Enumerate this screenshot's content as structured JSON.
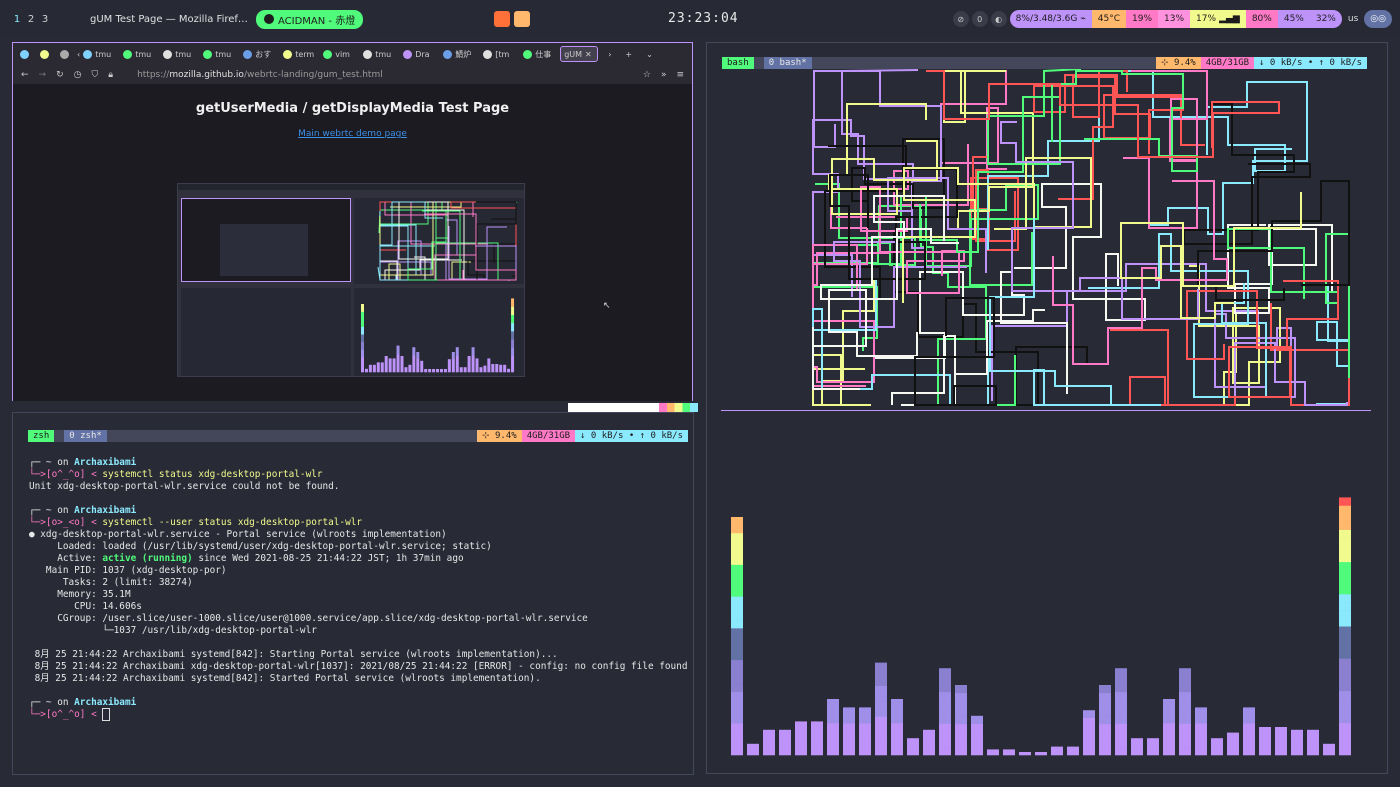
{
  "topbar": {
    "workspaces": [
      "1",
      "2",
      "3"
    ],
    "window_title": "gUM Test Page — Mozilla Firef…",
    "song": "ACIDMAN - 赤燈",
    "clock": "23:23:04",
    "status_items": [
      {
        "label": "8%/3.48/3.6G",
        "color": "#bd93f9"
      },
      {
        "label": "45°C",
        "color": "#ffb86c"
      },
      {
        "label": "19%",
        "color": "#ff79c6"
      },
      {
        "label": "13%",
        "color": "#ff92df"
      },
      {
        "label": "17%",
        "color": "#f1fa8c"
      },
      {
        "label": "80%",
        "color": "#ff79c6"
      },
      {
        "label": "45%",
        "color": "#bd93f9"
      },
      {
        "label": "32%",
        "color": "#bd93f9"
      },
      {
        "label": "us",
        "color": "#282a36"
      }
    ],
    "right_icons": [
      "eye-off-icon",
      "zero-icon",
      "steam-icon",
      "discord-icon"
    ],
    "zero_label": "0"
  },
  "browser": {
    "tabs": [
      {
        "label": "tmu",
        "color": "#7fd1ff"
      },
      {
        "label": "tmu",
        "color": "#50fa7b"
      },
      {
        "label": "tmu",
        "color": "#e0e0e0"
      },
      {
        "label": "tmu",
        "color": "#50fa7b"
      },
      {
        "label": "おす",
        "color": "#6a9fe8"
      },
      {
        "label": "term",
        "color": "#f1fa8c"
      },
      {
        "label": "vim",
        "color": "#50fa7b"
      },
      {
        "label": "tmu",
        "color": "#e0e0e0"
      },
      {
        "label": "Dra",
        "color": "#bd93f9"
      },
      {
        "label": "鯖炉",
        "color": "#6a9fe8"
      },
      {
        "label": "[tm",
        "color": "#e0e0e0"
      },
      {
        "label": "仕事",
        "color": "#50fa7b"
      },
      {
        "label": "gUM",
        "color": "#ff5555"
      }
    ],
    "url_prefix": "https://",
    "url_host": "mozilla.github.io",
    "url_path": "/webrtc-landing/gum_test.html",
    "page_title": "getUserMedia / getDisplayMedia Test Page",
    "page_link": "Main webrtc demo page"
  },
  "zsh": {
    "status_left": "zsh",
    "status_win": "0 zsh*",
    "cpu": "9.4%",
    "mem": "4GB/31GB",
    "net": "↓ 0 kB/s • ↑ 0 kB/s",
    "user": "Archaxibami",
    "lines": {
      "p1": "┌─ ~ on ",
      "c1prompt": "└─>[o^_^o] < ",
      "c1": "systemctl status xdg-desktop-portal-wlr",
      "o1": "Unit xdg-desktop-portal-wlr.service could not be found.",
      "p2": "┌─ ~ on ",
      "c2prompt": "└─>[o>_<o] < ",
      "c2": "systemctl --user status xdg-desktop-portal-wlr",
      "s1": "● xdg-desktop-portal-wlr.service - Portal service (wlroots implementation)",
      "s2": "     Loaded: loaded (/usr/lib/systemd/user/xdg-desktop-portal-wlr.service; static)",
      "s3a": "     Active: ",
      "s3b": "active (running)",
      "s3c": " since Wed 2021-08-25 21:44:22 JST; 1h 37min ago",
      "s4": "   Main PID: 1037 (xdg-desktop-por)",
      "s5": "      Tasks: 2 (limit: 38274)",
      "s6": "     Memory: 35.1M",
      "s7": "        CPU: 14.606s",
      "s8": "     CGroup: /user.slice/user-1000.slice/user@1000.service/app.slice/xdg-desktop-portal-wlr.service",
      "s9": "             └─1037 /usr/lib/xdg-desktop-portal-wlr",
      "j1": " 8月 25 21:44:22 Archaxibami systemd[842]: Starting Portal service (wlroots implementation)...",
      "j2": " 8月 25 21:44:22 Archaxibami xdg-desktop-portal-wlr[1037]: 2021/08/25 21:44:22 [ERROR] - config: no config file found",
      "j3": " 8月 25 21:44:22 Archaxibami systemd[842]: Started Portal service (wlroots implementation).",
      "p3": "┌─ ~ on ",
      "c3prompt": "└─>[o^_^o] < "
    }
  },
  "bash": {
    "status_left": "bash",
    "status_win": "0 bash*",
    "cpu": "9.4%",
    "mem": "4GB/31GB",
    "net": "↓ 0 kB/s • ↑ 0 kB/s"
  },
  "visualizer": {
    "levels": [
      0.85,
      0.04,
      0.09,
      0.09,
      0.12,
      0.12,
      0.2,
      0.17,
      0.17,
      0.33,
      0.2,
      0.06,
      0.09,
      0.31,
      0.25,
      0.14,
      0.02,
      0.02,
      0.01,
      0.01,
      0.03,
      0.03,
      0.16,
      0.25,
      0.31,
      0.06,
      0.06,
      0.2,
      0.31,
      0.17,
      0.06,
      0.08,
      0.17,
      0.1,
      0.1,
      0.09,
      0.09,
      0.04,
      0.92
    ]
  },
  "colors": {
    "green": "#50fa7b",
    "purple": "#bd93f9",
    "cyan": "#8be9fd",
    "pink": "#ff79c6",
    "orange": "#ffb86c",
    "yellow": "#f1fa8c",
    "red": "#ff5555"
  }
}
